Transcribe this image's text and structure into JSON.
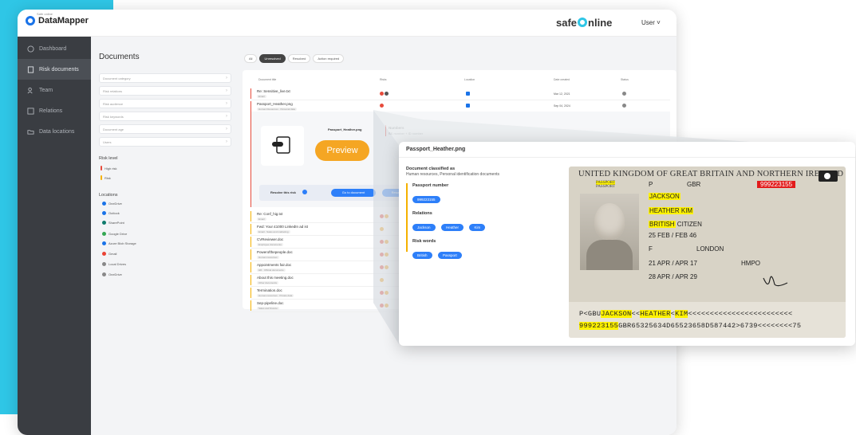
{
  "app": {
    "logo_small": "Safe online",
    "logo": "DataMapper",
    "brand_left": "safe",
    "brand_right": "nline",
    "user_menu": "User ˅"
  },
  "sidebar": {
    "items": [
      {
        "label": "Dashboard",
        "icon": "dashboard-icon"
      },
      {
        "label": "Risk documents",
        "icon": "risk-documents-icon"
      },
      {
        "label": "Team",
        "icon": "team-icon"
      },
      {
        "label": "Relations",
        "icon": "relations-icon"
      },
      {
        "label": "Data locations",
        "icon": "data-locations-icon"
      }
    ]
  },
  "docs_panel": {
    "title": "Documents",
    "filters": [
      "Document category",
      "Risk relations",
      "Risk audience",
      "Risk keywords",
      "Document age",
      "Users"
    ],
    "risk_level_title": "Risk level",
    "risk_levels": [
      {
        "label": "High risk",
        "color": "#e74c3c"
      },
      {
        "label": "Risk",
        "color": "#f5b100"
      }
    ],
    "locations_title": "Locations",
    "locations": [
      {
        "label": "OneDrive",
        "color": "#1a73e8"
      },
      {
        "label": "Outlook",
        "color": "#1a73e8"
      },
      {
        "label": "SharePoint",
        "color": "#0f7b6c"
      },
      {
        "label": "Google Drive",
        "color": "#34a853"
      },
      {
        "label": "Azure Blob Storage",
        "color": "#1a73e8"
      },
      {
        "label": "Gmail",
        "color": "#ea4335"
      },
      {
        "label": "Local Drives",
        "color": "#888888"
      },
      {
        "label": "OneDrive",
        "color": "#888888"
      }
    ]
  },
  "tabs": [
    "All",
    "Unresolved",
    "Resolved",
    "Action required"
  ],
  "table": {
    "headers": [
      "Document title",
      "Risks",
      "Location",
      "Date created",
      "Status"
    ],
    "rows": [
      {
        "name": "Re: Sensitive_live.txt",
        "tag": "Email",
        "date": "Mar 12, 2021"
      },
      {
        "name": "Passport_Heather.png",
        "tag": "Human Resources · Personal data",
        "date": "Sep 04, 2024"
      }
    ],
    "lower_rows": [
      {
        "name": "Re: Conf_hig.txt",
        "tag": "Email"
      },
      {
        "name": "Fwd: Your £1000 LinkedIn ad ist",
        "tag": "Email · Sales and marketing"
      },
      {
        "name": "CVReviewer.doc",
        "tag": "Employee documents"
      },
      {
        "name": "Powerofthepeople.doc",
        "tag": "Human resources"
      },
      {
        "name": "Appointments fair.doc",
        "tag": "HR · Official documents"
      },
      {
        "name": "About this meeting.doc",
        "tag": "Other documents"
      },
      {
        "name": "Termination.doc",
        "tag": "Human resources · Private data"
      },
      {
        "name": "Sep-pipeline.doc",
        "tag": "Sales and finance"
      }
    ]
  },
  "expanded": {
    "file_name": "Passport_Heather.png",
    "preview_label": "Preview",
    "numbers_title": "Numbers",
    "numbers_value": "SS number + ID number",
    "resolve_label": "Resolve this risk",
    "go_to_document": "Go to document",
    "resolved": "Resolved"
  },
  "popup": {
    "title": "Passport_Heather.png",
    "classified_title": "Document classified as",
    "classified_value": "Human resources, Personal identification documents",
    "passport_number_title": "Passport number",
    "passport_number": "999223155",
    "relations_title": "Relations",
    "relations": [
      "Jackson",
      "Heather",
      "Kim"
    ],
    "risk_words_title": "Risk words",
    "risk_words": [
      "British",
      "Passport"
    ]
  },
  "passport": {
    "header": "UNITED KINGDOM OF GREAT BRITAIN AND NORTHERN IRELAND",
    "passport_label_hl": "PASSPORT",
    "passport_label": "PASSPORT",
    "type": "P",
    "code": "GBR",
    "number": "999223155",
    "surname": "JACKSON",
    "given_names": "HEATHER KIM",
    "nationality_hl": "BRITISH",
    "nationality_rest": " CITIZEN",
    "dob": "25 FEB / FEB 46",
    "sex": "F",
    "place_of_birth": "LONDON",
    "date_of_issue": "21 APR / APR 17",
    "authority": "HMPO",
    "date_of_expiry": "28 APR / APR 29",
    "mrz1_a": "P<GBU",
    "mrz1_hl1": "JACKSON",
    "mrz1_b": "<<",
    "mrz1_hl2": "HEATHER",
    "mrz1_c": "<",
    "mrz1_hl3": "KIM",
    "mrz1_d": "<<<<<<<<<<<<<<<<<<<<<<<<",
    "mrz2_hl": "999223155",
    "mrz2_rest": "GBR65325634D65523658D587442>6739<<<<<<<<75"
  }
}
